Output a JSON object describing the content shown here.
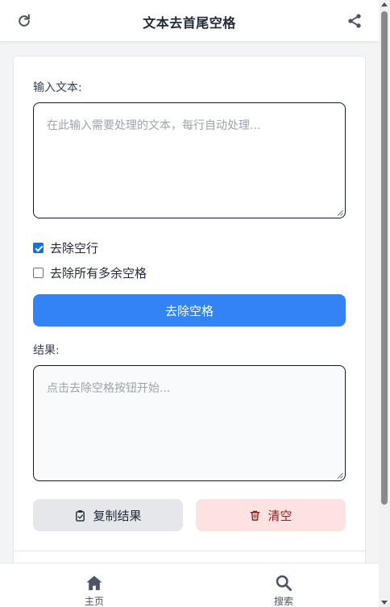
{
  "header": {
    "title": "文本去首尾空格",
    "left_icon": "refresh-icon",
    "right_icon": "share-icon"
  },
  "input": {
    "label": "输入文本:",
    "value": "",
    "placeholder": "在此输入需要处理的文本，每行自动处理..."
  },
  "options": [
    {
      "label": "去除空行",
      "checked": true
    },
    {
      "label": "去除所有多余空格",
      "checked": false
    }
  ],
  "actions": {
    "remove_spaces_label": "去除空格",
    "copy_label": "复制结果",
    "clear_label": "清空"
  },
  "result": {
    "label": "结果:",
    "value": "",
    "placeholder": "点击去除空格按钮开始..."
  },
  "nav": {
    "items": [
      {
        "label": "主页",
        "icon": "home-icon"
      },
      {
        "label": "搜索",
        "icon": "search-icon"
      }
    ]
  },
  "colors": {
    "primary": "#3383f6",
    "clear_bg": "#fee2e2",
    "clear_text": "#991b1b",
    "copy_bg": "#e5e7eb",
    "nav_icon": "#4b5563"
  }
}
